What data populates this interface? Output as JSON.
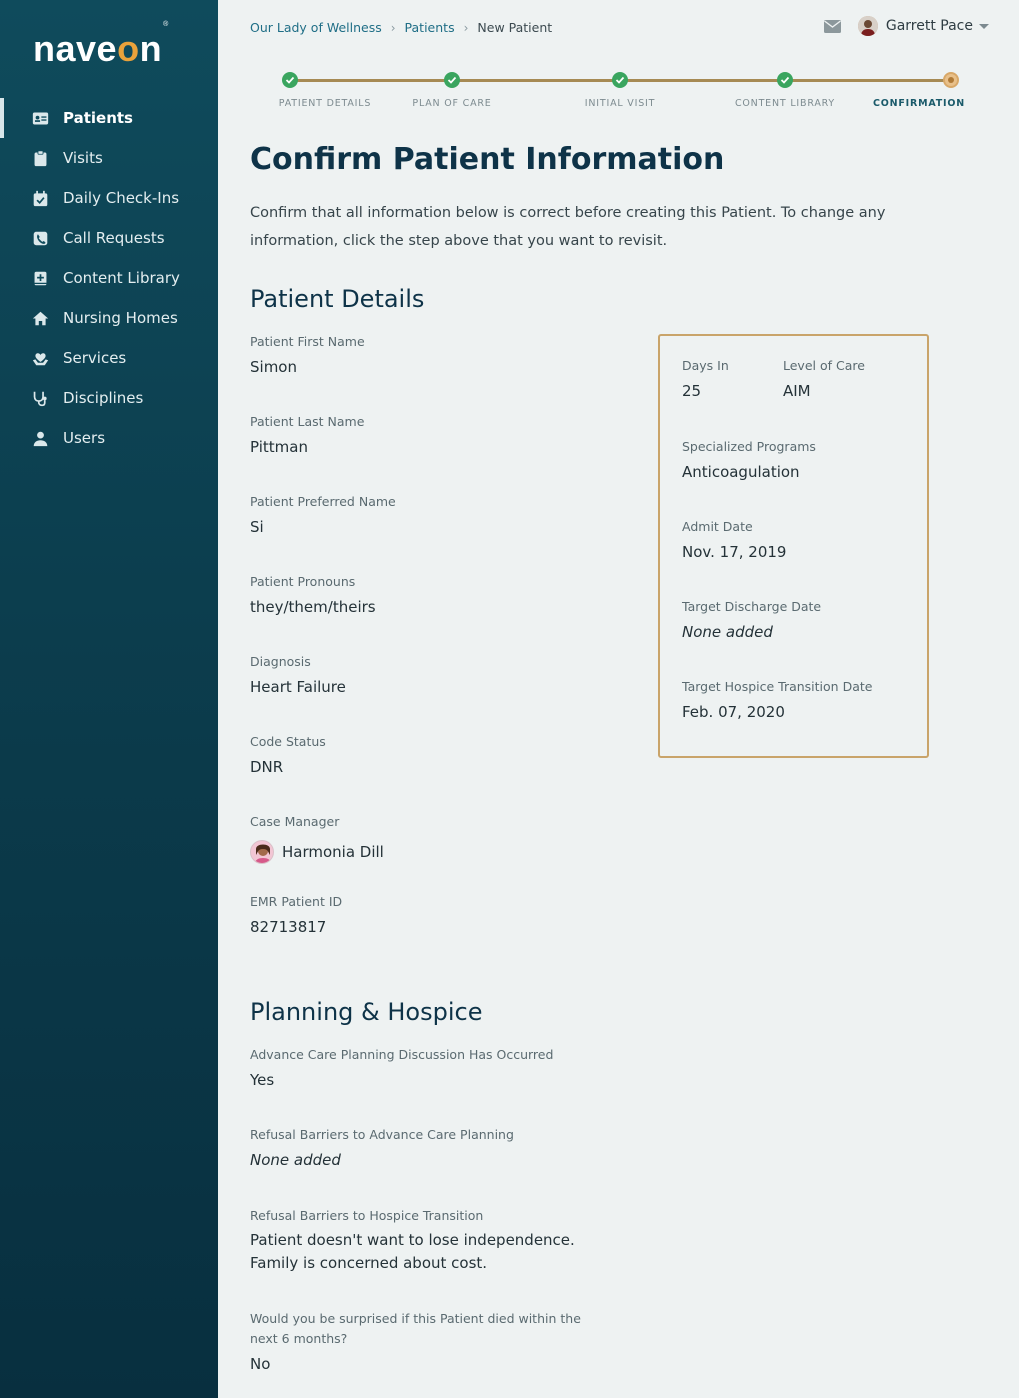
{
  "app": {
    "logo_text": "naveon"
  },
  "sidebar": {
    "items": [
      {
        "label": "Patients",
        "icon": "id-card-icon",
        "active": true
      },
      {
        "label": "Visits",
        "icon": "clipboard-icon"
      },
      {
        "label": "Daily Check-Ins",
        "icon": "calendar-check-icon"
      },
      {
        "label": "Call Requests",
        "icon": "phone-icon"
      },
      {
        "label": "Content Library",
        "icon": "book-plus-icon"
      },
      {
        "label": "Nursing Homes",
        "icon": "home-icon"
      },
      {
        "label": "Services",
        "icon": "hand-heart-icon"
      },
      {
        "label": "Disciplines",
        "icon": "stethoscope-icon"
      },
      {
        "label": "Users",
        "icon": "user-icon"
      }
    ]
  },
  "breadcrumb": {
    "org": "Our Lady of Wellness",
    "section": "Patients",
    "current": "New Patient"
  },
  "user": {
    "name": "Garrett Pace"
  },
  "stepper": {
    "steps": [
      {
        "label": "Patient Details",
        "state": "complete"
      },
      {
        "label": "Plan of Care",
        "state": "complete"
      },
      {
        "label": "Initial Visit",
        "state": "complete"
      },
      {
        "label": "Content Library",
        "state": "complete"
      },
      {
        "label": "Confirmation",
        "state": "current"
      }
    ]
  },
  "page": {
    "title": "Confirm Patient Information",
    "intro": "Confirm that all information below is correct before creating this Patient. To change any information, click the step above that you want to revisit."
  },
  "patient_details": {
    "heading": "Patient Details",
    "first_name": {
      "label": "Patient First Name",
      "value": "Simon"
    },
    "last_name": {
      "label": "Patient Last Name",
      "value": "Pittman"
    },
    "preferred_name": {
      "label": "Patient Preferred Name",
      "value": "Si"
    },
    "pronouns": {
      "label": "Patient Pronouns",
      "value": "they/them/theirs"
    },
    "diagnosis": {
      "label": "Diagnosis",
      "value": "Heart Failure"
    },
    "code_status": {
      "label": "Code Status",
      "value": "DNR"
    },
    "case_manager": {
      "label": "Case Manager",
      "value": "Harmonia Dill"
    },
    "emr_id": {
      "label": "EMR Patient ID",
      "value": "82713817"
    }
  },
  "summary_card": {
    "days_in": {
      "label": "Days In",
      "value": "25"
    },
    "level_of_care": {
      "label": "Level of Care",
      "value": "AIM"
    },
    "programs": {
      "label": "Specialized Programs",
      "value": "Anticoagulation"
    },
    "admit_date": {
      "label": "Admit Date",
      "value": "Nov. 17, 2019"
    },
    "target_discharge": {
      "label": "Target Discharge Date",
      "value": "None added"
    },
    "target_hospice": {
      "label": "Target Hospice Transition Date",
      "value": "Feb. 07, 2020"
    }
  },
  "planning": {
    "heading": "Planning & Hospice",
    "acp_discussion": {
      "label": "Advance Care Planning Discussion Has Occurred",
      "value": "Yes"
    },
    "acp_barriers": {
      "label": "Refusal Barriers to Advance Care Planning",
      "value": "None added"
    },
    "hospice_barriers": {
      "label": "Refusal Barriers to Hospice Transition",
      "line1": "Patient doesn't want to lose independence.",
      "line2": "Family is concerned about cost."
    },
    "surprise": {
      "label_line1": "Would you be surprised if this Patient died within the",
      "label_line2": "next 6 months?",
      "value": "No"
    }
  }
}
